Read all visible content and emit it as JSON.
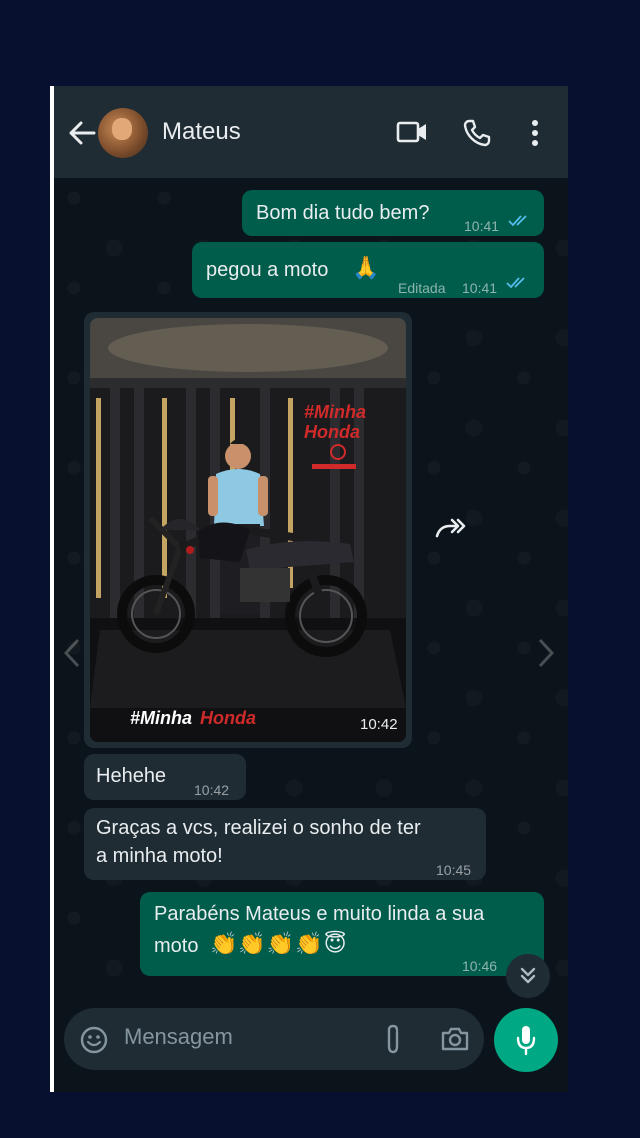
{
  "header": {
    "contact_name": "Mateus",
    "back_icon": "arrow-left-icon",
    "video_icon": "video-camera-icon",
    "call_icon": "phone-icon",
    "more_icon": "more-vertical-icon"
  },
  "messages": [
    {
      "direction": "out",
      "text": "Bom dia tudo bem?",
      "time": "10:41",
      "status": "read"
    },
    {
      "direction": "out",
      "text": "pegou a moto",
      "emoji": "🙏",
      "edited_label": "Editada",
      "time": "10:41",
      "status": "read"
    },
    {
      "direction": "in",
      "type": "image",
      "image_caption_overlay": [
        "#Minha",
        "Honda",
        "#MinhaHonda"
      ],
      "time": "10:42"
    },
    {
      "direction": "in",
      "text": "Hehehe",
      "time": "10:42"
    },
    {
      "direction": "in",
      "text_line1": "Graças a vcs, realizei o sonho de ter",
      "text_line2": "a minha moto!",
      "time": "10:45"
    },
    {
      "direction": "out",
      "text_line1": "Parabéns Mateus e muito linda a sua",
      "text_line2": "moto",
      "emojis": "👏👏👏👏😇",
      "time": "10:46"
    }
  ],
  "composer": {
    "placeholder": "Mensagem",
    "emoji_icon": "emoji-icon",
    "attach_icon": "paperclip-icon",
    "camera_icon": "camera-icon",
    "mic_icon": "microphone-icon"
  },
  "colors": {
    "page_bg": "#07102e",
    "header_bg": "#1f2c33",
    "chat_bg": "#0b141a",
    "outgoing_bubble": "#005c4b",
    "incoming_bubble": "#1f2c33",
    "read_ticks": "#53bdeb",
    "mic_button": "#00a884"
  }
}
